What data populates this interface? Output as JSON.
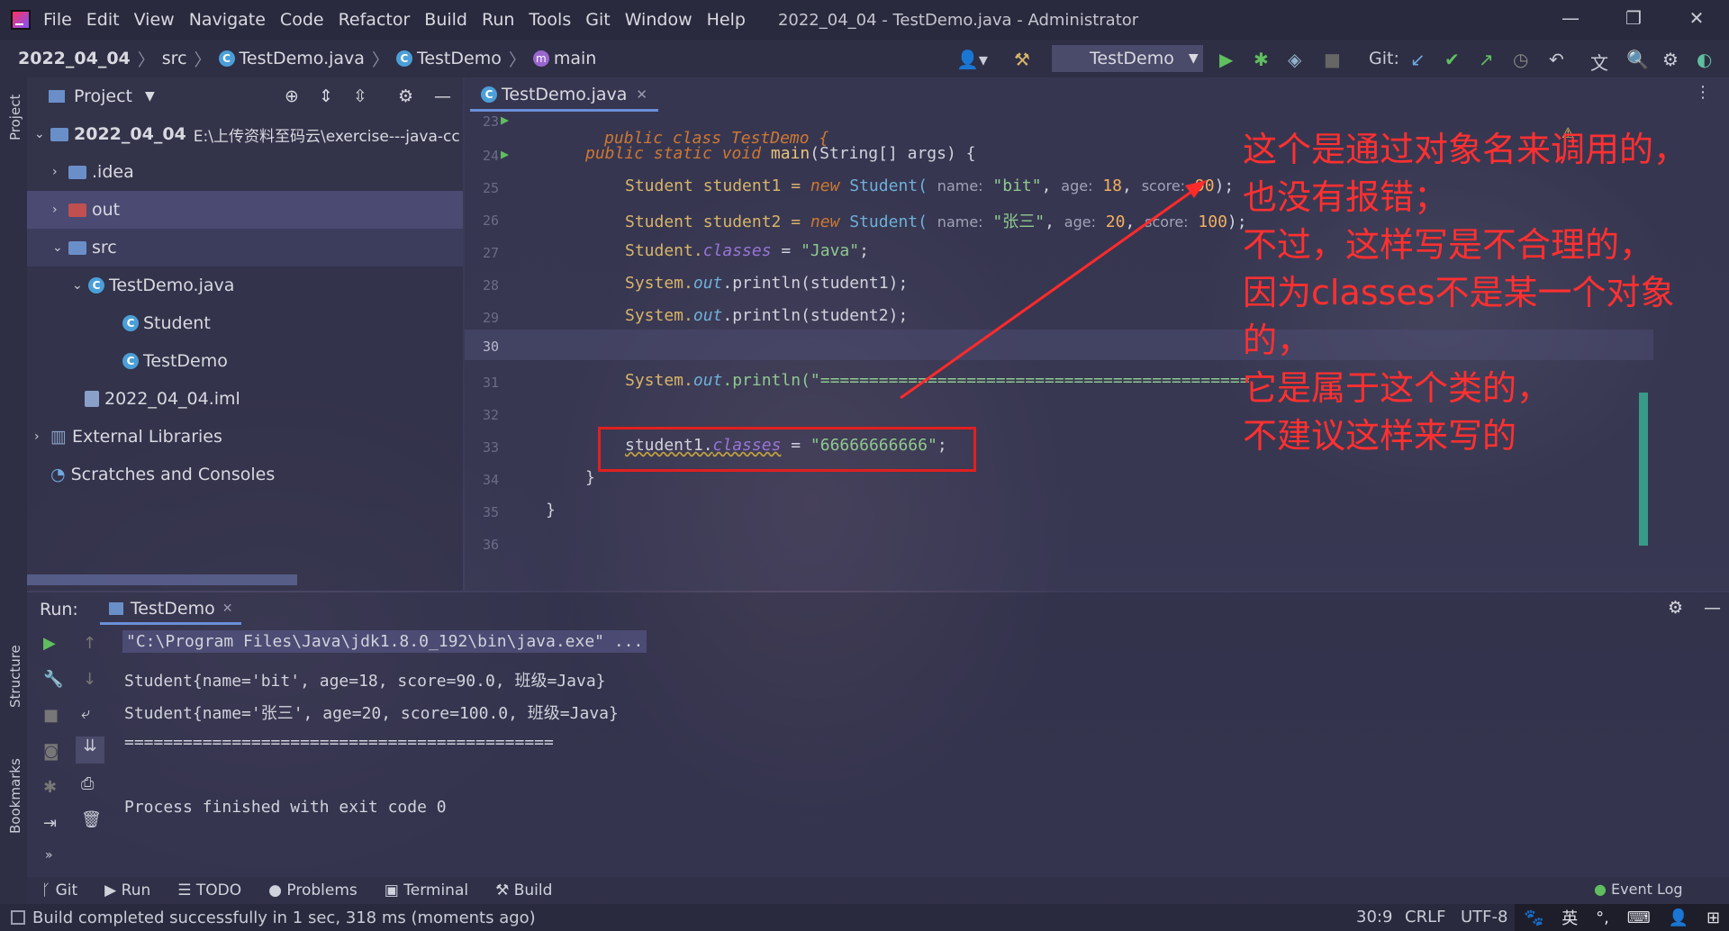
{
  "app": {
    "menu": [
      "File",
      "Edit",
      "View",
      "Navigate",
      "Code",
      "Refactor",
      "Build",
      "Run",
      "Tools",
      "Git",
      "Window",
      "Help"
    ],
    "window_title": "2022_04_04 - TestDemo.java - Administrator"
  },
  "breadcrumb": [
    "2022_04_04",
    "src",
    "TestDemo.java",
    "TestDemo",
    "main"
  ],
  "toolbar": {
    "run_config": "TestDemo",
    "git_label": "Git:"
  },
  "project": {
    "header": "Project",
    "tree": [
      {
        "label": "2022_04_04",
        "suffix": "E:\\上传资料至码云\\exercise---java-cc"
      },
      {
        "label": ".idea"
      },
      {
        "label": "out"
      },
      {
        "label": "src"
      },
      {
        "label": "TestDemo.java"
      },
      {
        "label": "Student"
      },
      {
        "label": "TestDemo"
      },
      {
        "label": "2022_04_04.iml"
      },
      {
        "label": "External Libraries"
      },
      {
        "label": "Scratches and Consoles"
      }
    ]
  },
  "editor": {
    "tab": "TestDemo.java",
    "line_numbers": [
      "23",
      "24",
      "25",
      "26",
      "27",
      "28",
      "29",
      "30",
      "31",
      "32",
      "33",
      "34",
      "35",
      "36"
    ],
    "code": {
      "l23": "public class TestDemo {",
      "l24_a": "public static void ",
      "l24_b": "main",
      "l24_c": "(String[] args) {",
      "l25_a": "Student student1 = ",
      "l25_new": "new",
      "l25_b": " Student( ",
      "l25_p1": "name:",
      "l25_v1": " \"bit\"",
      "l25_c": ", ",
      "l25_p2": "age:",
      "l25_v2": " 18",
      "l25_d": ", ",
      "l25_p3": "score:",
      "l25_v3": " 90",
      "l25_e": ");",
      "l26_a": "Student student2 = ",
      "l26_new": "new",
      "l26_b": " Student( ",
      "l26_p1": "name:",
      "l26_v1": " \"张三\"",
      "l26_c": ", ",
      "l26_p2": "age:",
      "l26_v2": " 20",
      "l26_d": ", ",
      "l26_p3": "score:",
      "l26_v3": " 100",
      "l26_e": ");",
      "l27_a": "Student.",
      "l27_b": "classes",
      "l27_c": " = ",
      "l27_d": "\"Java\"",
      "l27_e": ";",
      "l28_a": "System.",
      "l28_b": "out",
      "l28_c": ".println(student1);",
      "l29_a": "System.",
      "l29_b": "out",
      "l29_c": ".println(student2);",
      "l31_a": "System.",
      "l31_b": "out",
      "l31_c": ".println(\"============================================",
      "l33_a": "student1.",
      "l33_b": "classes",
      "l33_c": " = ",
      "l33_d": "\"66666666666\"",
      "l33_e": ";",
      "l34": "}",
      "l35": "}"
    }
  },
  "annotation": [
    "这个是通过对象名来调用的，",
    "也没有报错；",
    "不过，这样写是不合理的，",
    "因为classes不是某一个对象",
    "的，",
    "它是属于这个类的，",
    "不建议这样来写的"
  ],
  "run": {
    "label": "Run:",
    "tab": "TestDemo",
    "console": [
      "\"C:\\Program Files\\Java\\jdk1.8.0_192\\bin\\java.exe\" ...",
      "Student{name='bit', age=18, score=90.0, 班级=Java}",
      "Student{name='张三', age=20, score=100.0, 班级=Java}",
      "============================================",
      "",
      "Process finished with exit code 0"
    ]
  },
  "bottom_tools": [
    "Git",
    "Run",
    "TODO",
    "Problems",
    "Terminal",
    "Build"
  ],
  "event_log": "Event Log",
  "side_tabs": {
    "project": "Project",
    "structure": "Structure",
    "bookmarks": "Bookmarks"
  },
  "status": {
    "message": "Build completed successfully in 1 sec, 318 ms (moments ago)",
    "position": "30:9",
    "line_sep": "CRLF",
    "encoding": "UTF-8",
    "ime": "英"
  },
  "colors": {
    "accent": "#6a8fd8",
    "annotation": "#ff3030",
    "keyword": "#cc7832",
    "string": "#8fc98f"
  }
}
